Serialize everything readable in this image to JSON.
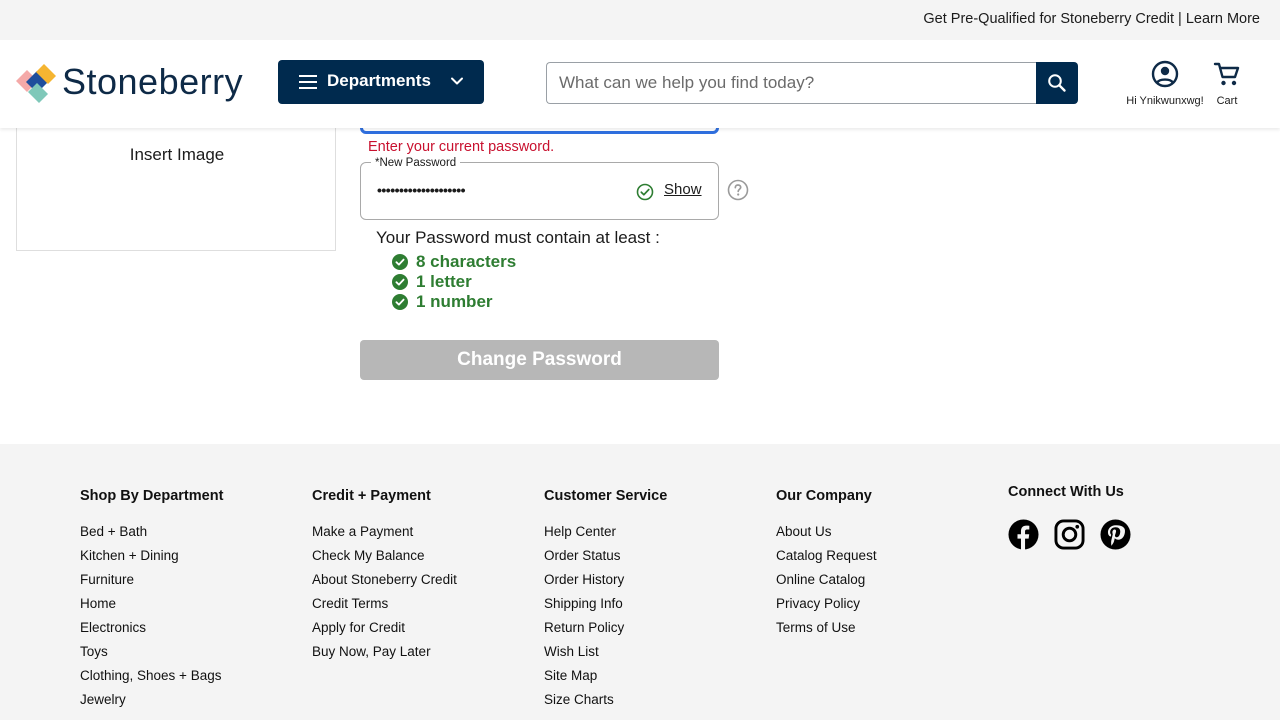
{
  "promo": {
    "text": "Get Pre-Qualified for Stoneberry Credit | Learn More"
  },
  "header": {
    "logo_text": "Stoneberry",
    "departments_label": "Departments",
    "search_placeholder": "What can we help you find today?",
    "account_label": "Hi Ynikwunxwg!",
    "cart_label": "Cart"
  },
  "colors": {
    "brand_navy": "#002a4e",
    "error_red": "#c8102e",
    "success_green": "#2e7d32",
    "focus_blue": "#2f6fde",
    "disabled_gray": "#b7b7b7"
  },
  "sidebar": {
    "image_label": "Insert Image"
  },
  "form": {
    "current_password_error": "Enter your current password.",
    "new_password_label": "*New Password",
    "new_password_value": "••••••••••••••••••••",
    "show_label": "Show",
    "requirements_heading": "Your Password must contain at least :",
    "requirements": [
      "8 characters",
      "1 letter",
      "1 number"
    ],
    "submit_label": "Change Password"
  },
  "footer": {
    "columns": [
      {
        "title": "Shop By Department",
        "links": [
          "Bed + Bath",
          "Kitchen + Dining",
          "Furniture",
          "Home",
          "Electronics",
          "Toys",
          "Clothing, Shoes + Bags",
          "Jewelry"
        ]
      },
      {
        "title": "Credit + Payment",
        "links": [
          "Make a Payment",
          "Check My Balance",
          "About Stoneberry Credit",
          "Credit Terms",
          "Apply for Credit",
          "Buy Now, Pay Later"
        ]
      },
      {
        "title": "Customer Service",
        "links": [
          "Help Center",
          "Order Status",
          "Order History",
          "Shipping Info",
          "Return Policy",
          "Wish List",
          "Site Map",
          "Size Charts"
        ]
      },
      {
        "title": "Our Company",
        "links": [
          "About Us",
          "Catalog Request",
          "Online Catalog",
          "Privacy Policy",
          "Terms of Use"
        ]
      }
    ],
    "social_title": "Connect With Us",
    "social_icons": [
      "facebook-icon",
      "instagram-icon",
      "pinterest-icon"
    ]
  }
}
